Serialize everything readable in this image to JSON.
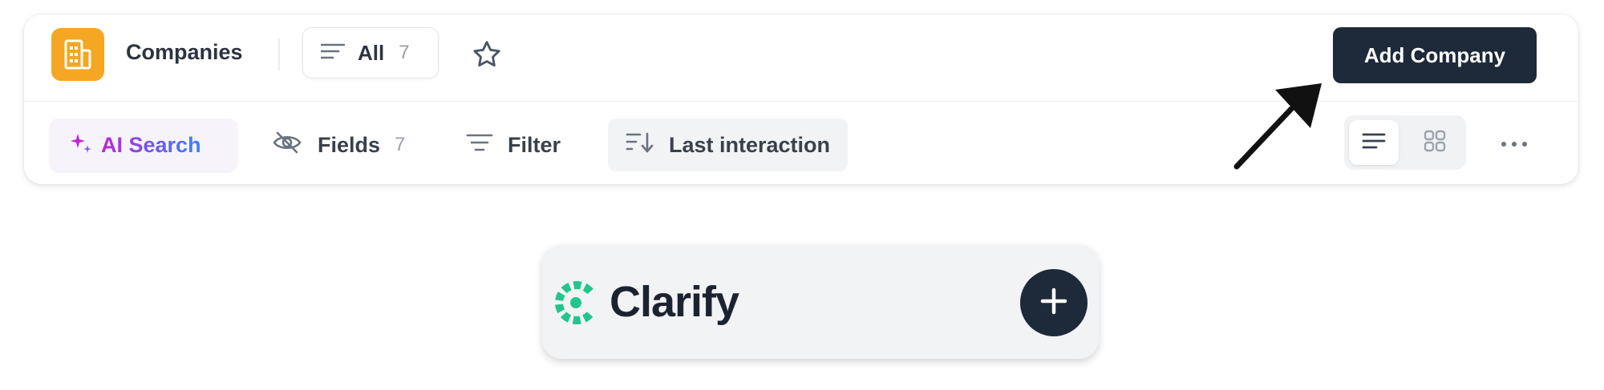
{
  "header": {
    "title": "Companies",
    "app_icon": "building-icon",
    "view": {
      "label": "All",
      "count": "7"
    },
    "add_button_label": "Add Company"
  },
  "toolbar": {
    "ai_search_label": "AI Search",
    "fields_label": "Fields",
    "fields_count": "7",
    "filter_label": "Filter",
    "sort_label": "Last interaction",
    "view_toggle": {
      "active": "list",
      "options": [
        "list",
        "grid"
      ]
    }
  },
  "brand": {
    "name": "Clarify",
    "logo_color": "#22c58b"
  },
  "colors": {
    "accent_dark": "#1e2a3a",
    "app_icon_bg": "#f5a623",
    "ai_gradient": [
      "#c026d3",
      "#6d5ce7",
      "#3b82f6"
    ]
  }
}
